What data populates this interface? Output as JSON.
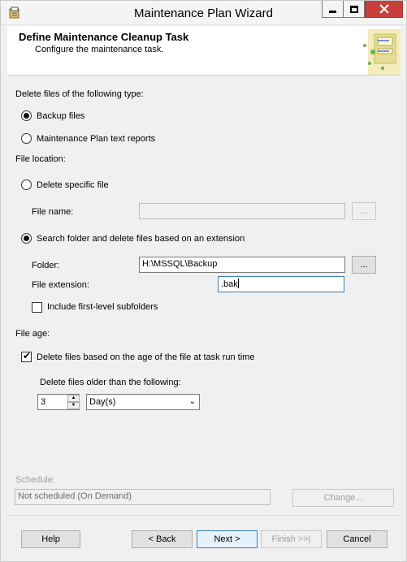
{
  "window": {
    "title": "Maintenance Plan Wizard"
  },
  "header": {
    "title": "Define Maintenance Cleanup Task",
    "subtitle": "Configure the maintenance task."
  },
  "delete_type": {
    "label": "Delete files of the following type:",
    "options": [
      "Backup files",
      "Maintenance Plan text reports"
    ],
    "selected": "Backup files"
  },
  "file_location": {
    "label": "File location:",
    "delete_specific_label": "Delete specific file",
    "file_name_label": "File name:",
    "file_name_value": "",
    "browse_file_label": "...",
    "search_folder_label": "Search folder and delete files based on an extension",
    "folder_label": "Folder:",
    "folder_value": "H:\\MSSQL\\Backup",
    "browse_folder_label": "...",
    "extension_label": "File extension:",
    "extension_value": ".bak",
    "subfolders_label": "Include first-level subfolders",
    "subfolders_checked": false,
    "selected": "Search folder and delete files based on an extension"
  },
  "file_age": {
    "label": "File age:",
    "delete_by_age_label": "Delete files based on the age of the file at task run time",
    "delete_by_age_checked": true,
    "older_than_label": "Delete files older than the following:",
    "amount": "3",
    "unit": "Day(s)"
  },
  "schedule": {
    "label": "Schedule:",
    "value": "Not scheduled (On Demand)",
    "change_label": "Change..."
  },
  "footer": {
    "help_label": "Help",
    "back_label": "< Back",
    "next_label": "Next >",
    "finish_label": "Finish >>|",
    "cancel_label": "Cancel"
  },
  "colors": {
    "close_button": "#c7403a",
    "focus_border": "#3c7fb1"
  }
}
